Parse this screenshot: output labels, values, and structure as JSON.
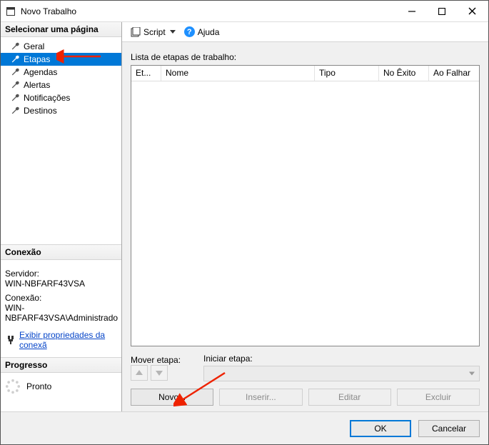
{
  "window": {
    "title": "Novo Trabalho"
  },
  "sidebar": {
    "header": "Selecionar uma página",
    "items": [
      {
        "label": "Geral"
      },
      {
        "label": "Etapas",
        "selected": true
      },
      {
        "label": "Agendas"
      },
      {
        "label": "Alertas"
      },
      {
        "label": "Notificações"
      },
      {
        "label": "Destinos"
      }
    ]
  },
  "connection": {
    "header": "Conexão",
    "server_label": "Servidor:",
    "server_value": "WIN-NBFARF43VSA",
    "conn_label": "Conexão:",
    "conn_value": "WIN-NBFARF43VSA\\Administrado",
    "props_link": "Exibir propriedades da conexã"
  },
  "progress": {
    "header": "Progresso",
    "status": "Pronto"
  },
  "toolbar": {
    "script_label": "Script",
    "help_label": "Ajuda"
  },
  "main": {
    "list_label": "Lista de etapas de trabalho:",
    "columns": {
      "c1": "Et...",
      "c2": "Nome",
      "c3": "Tipo",
      "c4": "No Êxito",
      "c5": "Ao Falhar"
    },
    "move_label": "Mover etapa:",
    "start_label": "Iniciar etapa:",
    "start_value": "",
    "buttons": {
      "novo": "Novo...",
      "inserir": "Inserir...",
      "editar": "Editar",
      "excluir": "Excluir"
    }
  },
  "footer": {
    "ok": "OK",
    "cancel": "Cancelar"
  }
}
